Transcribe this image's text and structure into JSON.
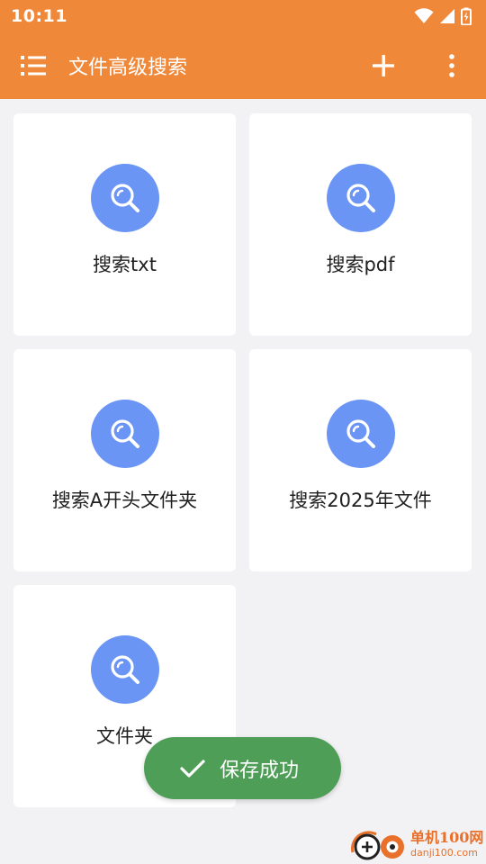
{
  "status_bar": {
    "time": "10:11"
  },
  "app_bar": {
    "title": "文件高级搜索",
    "menu_icon": "list-menu-icon",
    "add_icon": "plus-icon",
    "more_icon": "more-vertical-icon"
  },
  "cards": [
    {
      "label": "搜索txt",
      "icon": "search-icon"
    },
    {
      "label": "搜索pdf",
      "icon": "search-icon"
    },
    {
      "label": "搜索A开头文件夹",
      "icon": "search-icon"
    },
    {
      "label": "搜索2025年文件",
      "icon": "search-icon"
    },
    {
      "label": "文件夹",
      "icon": "search-icon"
    }
  ],
  "toast": {
    "text": "保存成功",
    "icon": "check-icon"
  },
  "watermark": {
    "name": "单机100网",
    "domain": "danji100.com"
  },
  "colors": {
    "app_bar": "#f0883a",
    "background": "#f2f2f4",
    "card": "#ffffff",
    "icon_circle": "#6b95f5",
    "toast": "#4f9e57"
  }
}
